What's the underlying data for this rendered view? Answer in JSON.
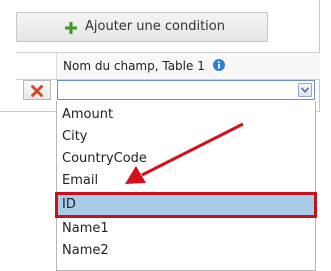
{
  "toolbar": {
    "add_condition_label": "Ajouter une condition",
    "add_icon": "plus-icon",
    "accent_color": "#3c9a22"
  },
  "table": {
    "column_header": "Nom du champ, Table 1",
    "info_icon": "info-icon",
    "delete_icon": "close-icon",
    "delete_color": "#d9411e"
  },
  "field_select": {
    "value": "",
    "options": [
      "Amount",
      "City",
      "CountryCode",
      "Email",
      "ID",
      "Name1",
      "Name2"
    ],
    "highlighted": "ID",
    "highlight_color": "#a9cce8",
    "annotation_color": "#c9101c"
  }
}
